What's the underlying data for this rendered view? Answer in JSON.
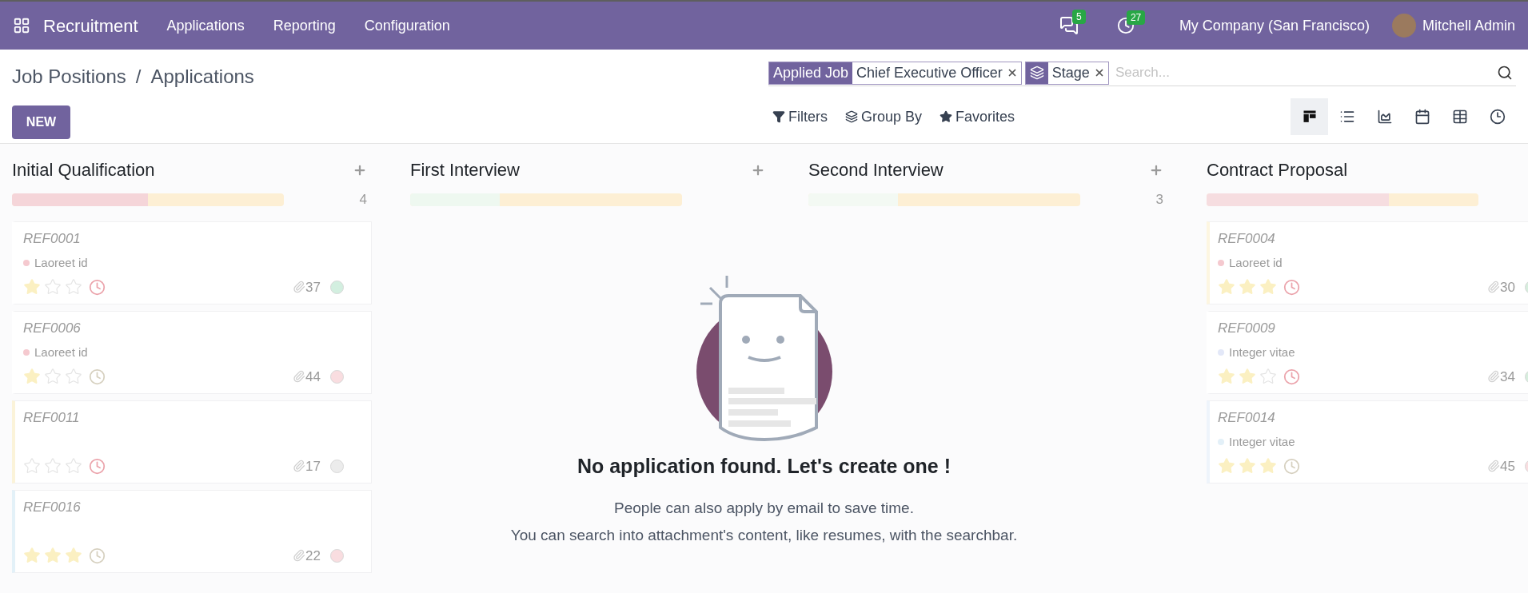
{
  "navbar": {
    "app_name": "Recruitment",
    "menus": [
      "Applications",
      "Reporting",
      "Configuration"
    ],
    "messages_count": "5",
    "activities_count": "27",
    "company": "My Company (San Francisco)",
    "user": "Mitchell Admin"
  },
  "breadcrumb": {
    "parent": "Job Positions",
    "separator": "/",
    "current": "Applications"
  },
  "new_button": "NEW",
  "search": {
    "facets": [
      {
        "kind": "field",
        "label": "Applied Job",
        "value": "Chief Executive Officer"
      },
      {
        "kind": "group",
        "value": "Stage"
      }
    ],
    "placeholder": "Search..."
  },
  "search_options": [
    "Filters",
    "Group By",
    "Favorites"
  ],
  "views": [
    {
      "kind": "kanban",
      "selected": true
    },
    {
      "kind": "list",
      "selected": false
    },
    {
      "kind": "graph",
      "selected": false
    },
    {
      "kind": "calendar",
      "selected": false
    },
    {
      "kind": "pivot",
      "selected": false
    },
    {
      "kind": "activity",
      "selected": false
    }
  ],
  "columns": [
    {
      "title": "Initial Qualification",
      "count": "4",
      "progress": {
        "level": 0.5,
        "color": "#f5d5d9"
      },
      "cards": [
        {
          "ref": "REF0001",
          "tag": {
            "label": "Laoreet id",
            "color": "#f5c9cf"
          },
          "stars": 1,
          "overdue": true,
          "attachments": "37",
          "status": {
            "color": "#d3efe0"
          },
          "color": "#ffffff"
        },
        {
          "ref": "REF0006",
          "tag": {
            "label": "Laoreet id",
            "color": "#f5c9cf"
          },
          "stars": 1,
          "overdue": false,
          "attachments": "44",
          "status": {
            "color": "#f9dde0"
          },
          "color": "#ffffff"
        },
        {
          "ref": "REF0011",
          "stars": 0,
          "overdue": true,
          "attachments": "17",
          "status": {
            "color": "#ececec"
          },
          "color": "#fbf3d9"
        },
        {
          "ref": "REF0016",
          "stars": 3,
          "overdue": false,
          "attachments": "22",
          "status": {
            "color": "#f9dde0"
          },
          "color": "#e3f1f8"
        }
      ]
    },
    {
      "title": "First Interview",
      "progress": {
        "level": 0.33,
        "color": "#eef8f0"
      }
    },
    {
      "title": "Second Interview",
      "count": "3",
      "progress": {
        "level": 0.33,
        "color": "#f3f9f3"
      }
    },
    {
      "title": "Contract Proposal",
      "progress": {
        "level": 0.67,
        "color": "#f6dde0"
      },
      "cards": [
        {
          "ref": "REF0004",
          "tag": {
            "label": "Laoreet id",
            "color": "#f5c9cf"
          },
          "stars": 3,
          "overdue": true,
          "attachments": "30",
          "status": {
            "color": "#d6eedd"
          },
          "color": "#fdf6e1"
        },
        {
          "ref": "REF0009",
          "tag": {
            "label": "Integer vitae",
            "color": "#e3e8f8"
          },
          "stars": 2,
          "overdue": true,
          "attachments": "34",
          "status": {
            "color": "#d6eedd"
          },
          "color": "#ffffff"
        },
        {
          "ref": "REF0014",
          "tag": {
            "label": "Integer vitae",
            "color": "#e3f0f8"
          },
          "stars": 3,
          "overdue": false,
          "attachments": "45",
          "status": {
            "color": "#f9dde0"
          },
          "color": "#eef4fb"
        }
      ]
    }
  ],
  "empty_state": {
    "title": "No application found. Let's create one !",
    "lines": [
      "People can also apply by email to save time.",
      "You can search into attachment's content, like resumes, with the searchbar."
    ]
  }
}
